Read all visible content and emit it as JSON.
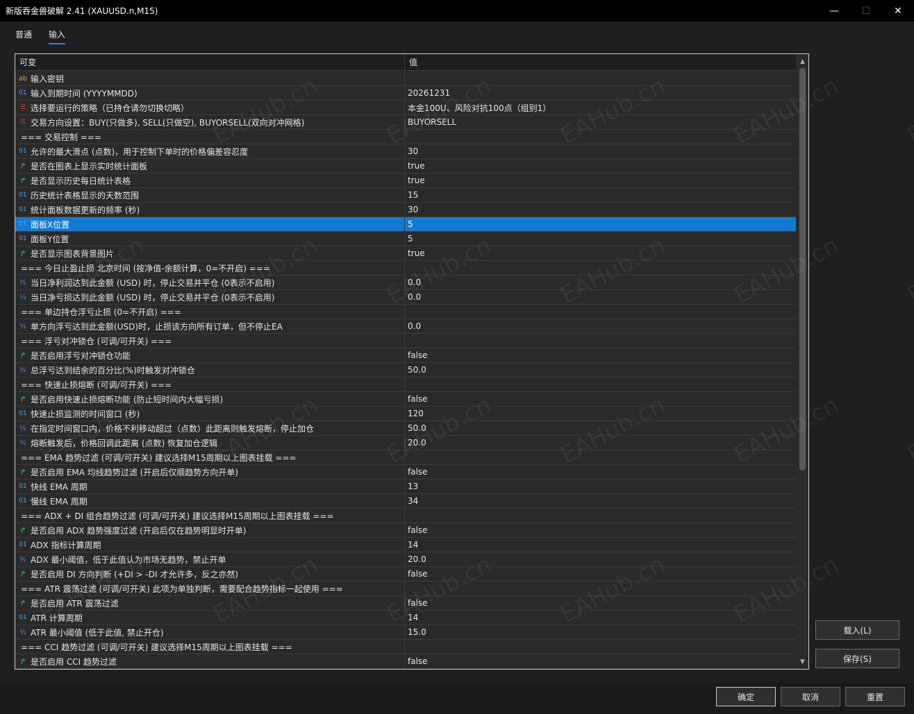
{
  "window": {
    "title": "新版吞金兽破解 2.41 (XAUUSD.n,M15)",
    "minimize": "—",
    "maximize": "☐",
    "close": "✕"
  },
  "tabs": [
    {
      "label": "普通"
    },
    {
      "label": "输入"
    }
  ],
  "table": {
    "headers": {
      "variable": "可变",
      "value": "值"
    },
    "rows": [
      {
        "type": "str",
        "icon": "ab",
        "name": "输入密钥",
        "value": ""
      },
      {
        "type": "int",
        "icon": "01",
        "name": "输入到期时间 (YYYYMMDD)",
        "value": "20261231"
      },
      {
        "type": "enum",
        "icon": "☰",
        "name": "选择要运行的策略（已持仓请勿切换切略）",
        "value": "本金100U、风险对抗100点（组别1）"
      },
      {
        "type": "enum",
        "icon": "☰",
        "name": "交易方向设置：BUY(只做多), SELL(只做空), BUYORSELL(双向对冲网格)",
        "value": "BUYORSELL"
      },
      {
        "type": "none",
        "icon": "",
        "name": "=== 交易控制 ===",
        "value": ""
      },
      {
        "type": "int",
        "icon": "01",
        "name": "允许的最大滑点 (点数)，用于控制下单时的价格偏差容忍度",
        "value": "30"
      },
      {
        "type": "bool",
        "icon": "↱",
        "name": "是否在图表上显示实时统计面板",
        "value": "true"
      },
      {
        "type": "bool",
        "icon": "↱",
        "name": "是否显示历史每日统计表格",
        "value": "true"
      },
      {
        "type": "int",
        "icon": "01",
        "name": "历史统计表格显示的天数范围",
        "value": "15"
      },
      {
        "type": "int",
        "icon": "01",
        "name": "统计面板数据更新的频率 (秒)",
        "value": "30"
      },
      {
        "type": "int",
        "icon": "01",
        "name": "面板X位置",
        "value": "5",
        "selected": true
      },
      {
        "type": "int",
        "icon": "01",
        "name": "面板Y位置",
        "value": "5"
      },
      {
        "type": "bool",
        "icon": "↱",
        "name": "是否显示图表背景图片",
        "value": "true"
      },
      {
        "type": "none",
        "icon": "",
        "name": "=== 今日止盈止损 北京时间 (按净值-余额计算，0=不开启) ===",
        "value": ""
      },
      {
        "type": "dbl",
        "icon": "½",
        "name": "当日净利润达到此金额 (USD) 时，停止交易并平仓 (0表示不启用)",
        "value": "0.0"
      },
      {
        "type": "dbl",
        "icon": "½",
        "name": "当日净亏损达到此金额 (USD) 时，停止交易并平仓 (0表示不启用)",
        "value": "0.0"
      },
      {
        "type": "none",
        "icon": "",
        "name": "=== 单边持仓浮亏止损 (0=不开启) ===",
        "value": ""
      },
      {
        "type": "dbl",
        "icon": "½",
        "name": "单方向浮亏达到此金额(USD)时，止损该方向所有订单，但不停止EA",
        "value": "0.0"
      },
      {
        "type": "none",
        "icon": "",
        "name": "=== 浮亏对冲锁仓 (可调/可开关) ===",
        "value": ""
      },
      {
        "type": "bool",
        "icon": "↱",
        "name": "是否启用浮亏对冲锁仓功能",
        "value": "false"
      },
      {
        "type": "dbl",
        "icon": "½",
        "name": "总浮亏达到结余的百分比(%)时触发对冲锁仓",
        "value": "50.0"
      },
      {
        "type": "none",
        "icon": "",
        "name": "=== 快速止损熔断 (可调/可开关) ===",
        "value": ""
      },
      {
        "type": "bool",
        "icon": "↱",
        "name": "是否启用快速止损熔断功能 (防止短时间内大幅亏损)",
        "value": "false"
      },
      {
        "type": "int",
        "icon": "01",
        "name": "快速止损监测的时间窗口 (秒)",
        "value": "120"
      },
      {
        "type": "dbl",
        "icon": "½",
        "name": "在指定时间窗口内，价格不利移动超过（点数）此距离则触发熔断，停止加仓",
        "value": "50.0"
      },
      {
        "type": "dbl",
        "icon": "½",
        "name": "熔断触发后，价格回调此距离 (点数) 恢复加仓逻辑",
        "value": "20.0"
      },
      {
        "type": "none",
        "icon": "",
        "name": "=== EMA 趋势过滤 (可调/可开关) 建议选择M15周期以上图表挂载 ===",
        "value": ""
      },
      {
        "type": "bool",
        "icon": "↱",
        "name": "是否启用 EMA 均线趋势过滤 (开启后仅顺趋势方向开单)",
        "value": "false"
      },
      {
        "type": "int",
        "icon": "01",
        "name": "快线 EMA 周期",
        "value": "13"
      },
      {
        "type": "int",
        "icon": "01",
        "name": "慢线 EMA 周期",
        "value": "34"
      },
      {
        "type": "none",
        "icon": "",
        "name": "=== ADX + DI 组合趋势过滤 (可调/可开关) 建议选择M15周期以上图表挂载 ===",
        "value": ""
      },
      {
        "type": "bool",
        "icon": "↱",
        "name": "是否启用 ADX 趋势强度过滤 (开启后仅在趋势明显时开单)",
        "value": "false"
      },
      {
        "type": "int",
        "icon": "01",
        "name": "ADX 指标计算周期",
        "value": "14"
      },
      {
        "type": "dbl",
        "icon": "½",
        "name": "ADX 最小阈值，低于此值认为市场无趋势，禁止开单",
        "value": "20.0"
      },
      {
        "type": "bool",
        "icon": "↱",
        "name": "是否启用 DI 方向判断 (+DI > -DI 才允许多，反之亦然)",
        "value": "false"
      },
      {
        "type": "none",
        "icon": "",
        "name": "=== ATR 震荡过滤 (可调/可开关) 此项为单独判断，需要配合趋势指标一起使用 ===",
        "value": ""
      },
      {
        "type": "bool",
        "icon": "↱",
        "name": "是否启用 ATR 震荡过滤",
        "value": "false"
      },
      {
        "type": "int",
        "icon": "01",
        "name": "ATR 计算周期",
        "value": "14"
      },
      {
        "type": "dbl",
        "icon": "½",
        "name": "ATR 最小阈值 (低于此值, 禁止开仓)",
        "value": "15.0"
      },
      {
        "type": "none",
        "icon": "",
        "name": "=== CCI 趋势过滤 (可调/可开关) 建议选择M15周期以上图表挂载 ===",
        "value": ""
      },
      {
        "type": "bool",
        "icon": "↱",
        "name": "是否启用 CCI 趋势过滤",
        "value": "false"
      }
    ]
  },
  "side_buttons": {
    "load": "载入(L)",
    "save": "保存(S)"
  },
  "footer_buttons": {
    "ok": "确定",
    "cancel": "取消",
    "reset": "重置"
  },
  "watermark": "EAHub.cn",
  "colors": {
    "selection": "#1479d2",
    "tab_underline": "#2b8be8",
    "titlebar": "#000000",
    "background": "#1f1f1f"
  }
}
